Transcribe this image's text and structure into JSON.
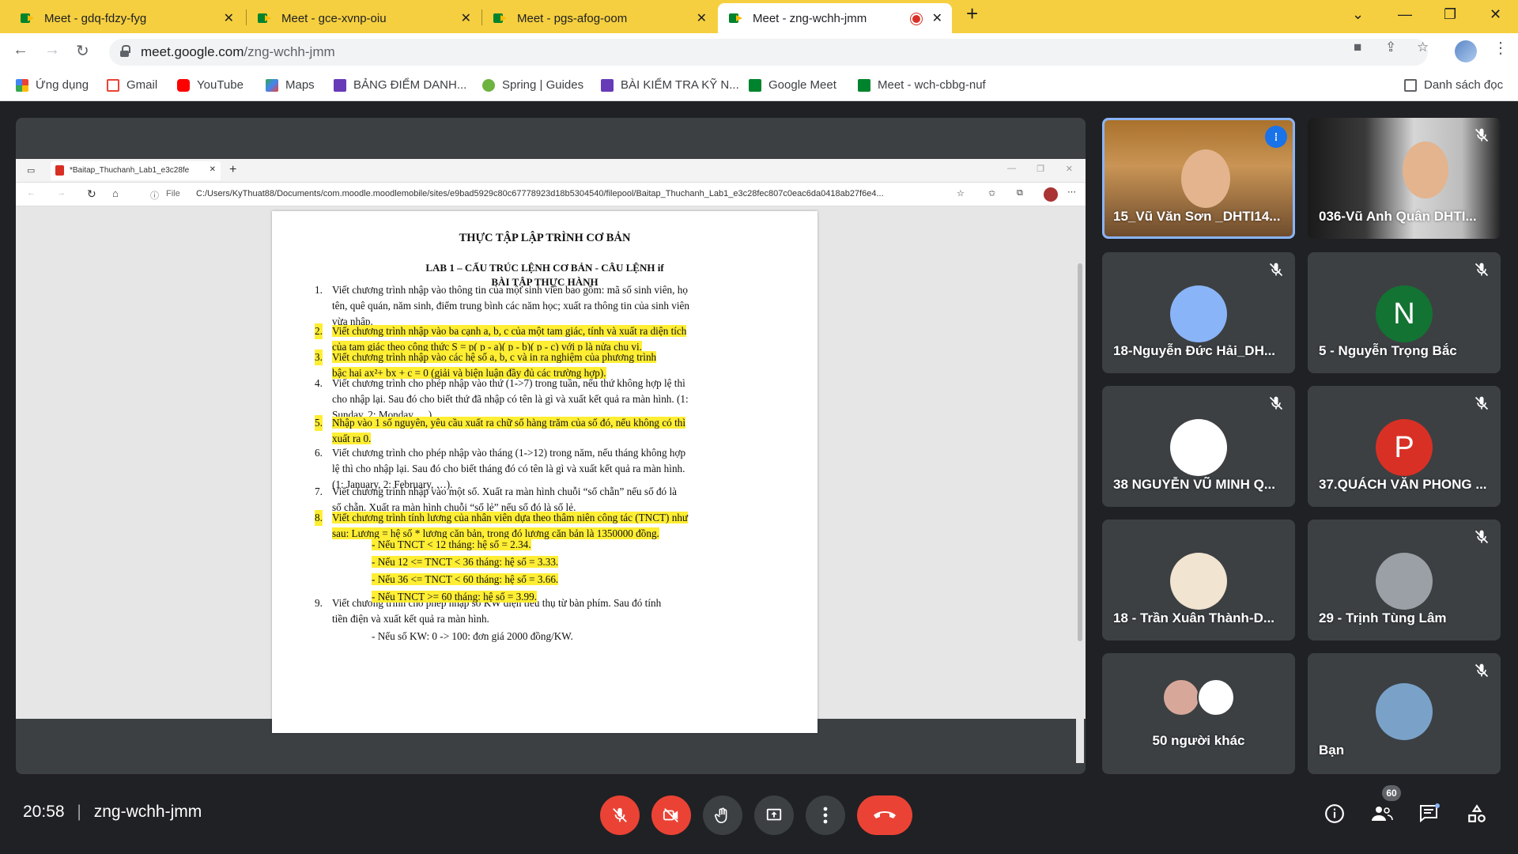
{
  "tabs": [
    {
      "title": "Meet - gdq-fdzy-fyg"
    },
    {
      "title": "Meet - gce-xvnp-oiu"
    },
    {
      "title": "Meet - pgs-afog-oom"
    },
    {
      "title": "Meet - zng-wchh-jmm"
    }
  ],
  "address": {
    "host": "meet.google.com",
    "path": "/zng-wchh-jmm"
  },
  "bookmarks": [
    {
      "label": "Ứng dụng",
      "color": "#ea4335"
    },
    {
      "label": "Gmail",
      "color": "#ea4335"
    },
    {
      "label": "YouTube",
      "color": "#ff0000"
    },
    {
      "label": "Maps",
      "color": "#34a853"
    },
    {
      "label": "BẢNG ĐIỂM DANH...",
      "color": "#673ab7"
    },
    {
      "label": "Spring | Guides",
      "color": "#6db33f"
    },
    {
      "label": "BÀI KIỂM TRA KỸ N...",
      "color": "#673ab7"
    },
    {
      "label": "Google Meet",
      "color": "#00832d"
    },
    {
      "label": "Meet - wch-cbbg-nuf",
      "color": "#00832d"
    }
  ],
  "reading_list": "Danh sách đọc",
  "shared": {
    "tab_title": "*Baitap_Thuchanh_Lab1_e3c28fe",
    "file_label": "File",
    "file_path": "C:/Users/KyThuat88/Documents/com.moodle.moodlemobile/sites/e9bad5929c80c67778923d18b5304540/filepool/Baitap_Thuchanh_Lab1_e3c28fec807c0eac6da0418ab27f6e4...",
    "title": "THỰC TẬP LẬP TRÌNH CƠ BẢN",
    "lab": "LAB 1 – CẤU TRÚC LỆNH CƠ BẢN - CÂU LỆNH if",
    "subtitle": "BÀI TẬP THỰC HÀNH",
    "items": [
      {
        "n": "1.",
        "lines": [
          "Viết chương trình nhập vào thông tin của một sinh viên bao gồm: mã số sinh viên, họ",
          "tên, quê quán, năm sinh, điểm trung bình các năm học; xuất ra thông tin của sinh viên",
          "vừa nhập."
        ],
        "hl": false
      },
      {
        "n": "2.",
        "lines": [
          "Viết chương trình nhập vào ba cạnh a, b, c của một tam giác, tính và xuất ra diện tích",
          "của tam giác theo công thức S = p( p - a)( p - b)( p - c) với p là nửa chu vi."
        ],
        "hl": true
      },
      {
        "n": "3.",
        "lines": [
          "Viết chương trình nhập vào các hệ số a, b, c và in ra nghiệm của phương trình",
          "bậc hai ax²+ bx + c = 0 (giải và biện luận đầy đủ các trường hợp)."
        ],
        "hl": true
      },
      {
        "n": "4.",
        "lines": [
          "Viết chương trình cho phép nhập vào thứ (1->7) trong tuần, nếu thứ không hợp lệ thì",
          "cho nhập lại. Sau đó cho biết thứ đã nhập có tên là gì và xuất kết quả ra màn hình. (1:",
          "Sunday, 2: Monday, …)"
        ],
        "hl": false
      },
      {
        "n": "5.",
        "lines": [
          "Nhập vào 1 số nguyên, yêu cầu xuất ra chữ số hàng trăm của số đó, nếu không có thì",
          "xuất ra 0."
        ],
        "hl": true
      },
      {
        "n": "6.",
        "lines": [
          "Viết chương trình cho phép nhập vào tháng (1->12) trong năm, nếu tháng không hợp",
          "lệ thì cho nhập lại. Sau đó cho biết tháng đó có tên là gì và xuất kết quả ra màn hình.",
          "(1: January, 2: February, …)."
        ],
        "hl": false
      },
      {
        "n": "7.",
        "lines": [
          "Viết chương trình nhập vào một số. Xuất ra màn hình chuỗi “số chẵn” nếu số đó là",
          "số chẵn. Xuất ra màn hình chuỗi “số lẻ” nếu số đó là số lẻ."
        ],
        "hl": false
      },
      {
        "n": "8.",
        "lines": [
          "Viết chương trình tính lương của nhân viên dựa theo thâm niên công tác (TNCT) như",
          "sau: Lương = hệ số * lương căn bản, trong đó lương căn bản là 1350000 đồng."
        ],
        "hl": true
      },
      {
        "n": "9.",
        "lines": [
          "Viết chương trình cho phép nhập số KW điện tiêu thụ từ bàn phím. Sau đó tính",
          "tiền điện và xuất kết quả ra màn hình."
        ],
        "hl": false
      }
    ],
    "subitems8": [
      "-    Nếu TNCT < 12 tháng: hệ số = 2.34.",
      "-    Nếu 12 <= TNCT < 36 tháng: hệ số = 3.33.",
      "-    Nếu 36 <= TNCT < 60 tháng: hệ số = 3.66.",
      "-    Nếu TNCT >= 60 tháng: hệ số = 3.99."
    ],
    "subitem9": "-    Nếu số KW: 0 -> 100: đơn giá 2000 đồng/KW."
  },
  "participants": [
    {
      "name": "15_Vũ Văn Sơn _DHTI14...",
      "kind": "video",
      "speaking": true
    },
    {
      "name": "036-Vũ Anh Quân DHTI...",
      "kind": "video2",
      "muted": true
    },
    {
      "name": "18-Nguyễn Đức Hải_DH...",
      "kind": "avatar",
      "muted": true,
      "bg": "#8ab4f8"
    },
    {
      "name": "5 - Nguyễn Trọng Bắc",
      "kind": "letter",
      "letter": "N",
      "muted": true,
      "bg": "#137333"
    },
    {
      "name": "38 NGUYỄN VŨ MINH Q...",
      "kind": "avatar",
      "muted": true,
      "bg": "#ffffff"
    },
    {
      "name": "37.QUÁCH VĂN PHONG ...",
      "kind": "letter",
      "letter": "P",
      "muted": true,
      "bg": "#d93025"
    },
    {
      "name": "18 - Trần Xuân Thành-D...",
      "kind": "avatar",
      "muted": false,
      "bg": "#f1e4d0"
    },
    {
      "name": "29 - Trịnh Tùng Lâm",
      "kind": "avatar",
      "muted": true,
      "bg": "#9aa0a6"
    },
    {
      "name": "50 người khác",
      "kind": "others"
    },
    {
      "name": "Bạn",
      "kind": "avatar",
      "muted": true,
      "bg": "#7aa2c9"
    }
  ],
  "meeting": {
    "time": "20:58",
    "separator": "|",
    "code": "zng-wchh-jmm",
    "participant_count": "60"
  }
}
